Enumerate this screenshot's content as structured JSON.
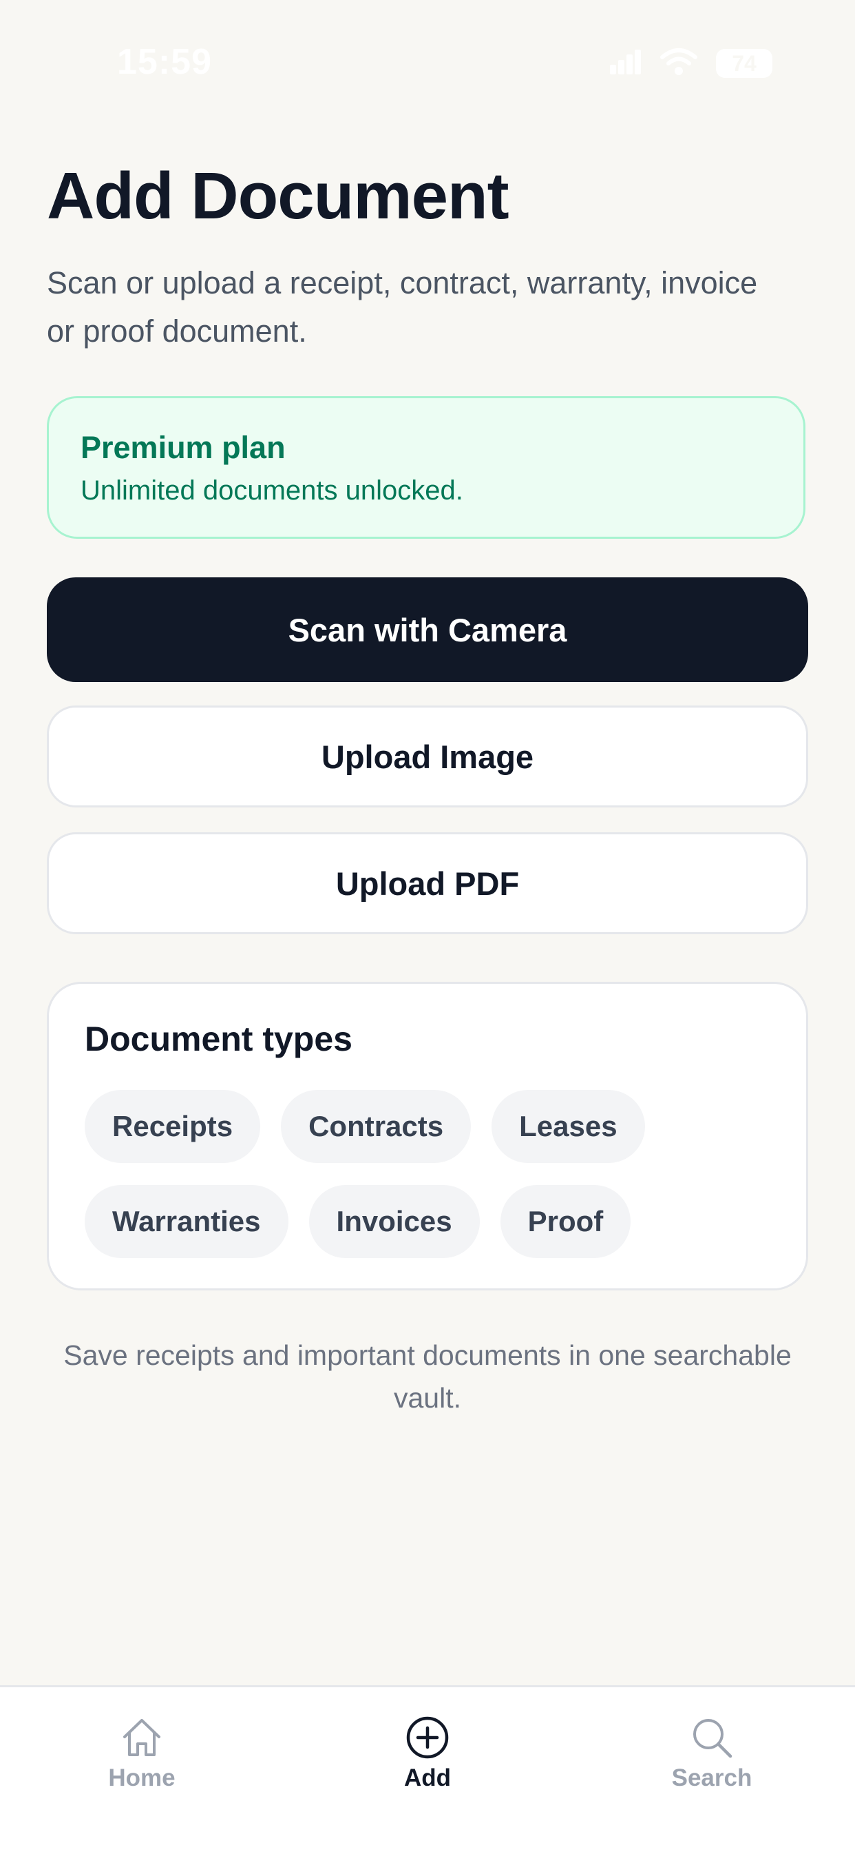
{
  "status_bar": {
    "time": "15:59",
    "battery": "74",
    "icons": [
      "signal-icon",
      "wifi-icon",
      "battery-icon"
    ]
  },
  "page": {
    "title": "Add Document",
    "subtitle": "Scan or upload a receipt, contract, warranty, invoice or proof document."
  },
  "plan": {
    "title": "Premium plan",
    "description": "Unlimited documents unlocked."
  },
  "actions": {
    "scan_label": "Scan with Camera",
    "upload_image_label": "Upload Image",
    "upload_pdf_label": "Upload PDF"
  },
  "document_types": {
    "title": "Document types",
    "chips": [
      "Receipts",
      "Contracts",
      "Leases",
      "Warranties",
      "Invoices",
      "Proof"
    ]
  },
  "footer_note": "Save receipts and important documents in one searchable vault.",
  "tab_bar": {
    "tabs": [
      {
        "label": "Home",
        "icon": "home-icon",
        "active": false
      },
      {
        "label": "Add",
        "icon": "plus-circle-icon",
        "active": true
      },
      {
        "label": "Search",
        "icon": "search-icon",
        "active": false
      }
    ]
  },
  "colors": {
    "background": "#f8f7f3",
    "primary": "#111827",
    "accent_green": "#047857",
    "plan_bg": "#ecfdf3",
    "plan_border": "#a7f3d0",
    "muted": "#6b7280",
    "inactive_tab": "#9ca3af"
  }
}
